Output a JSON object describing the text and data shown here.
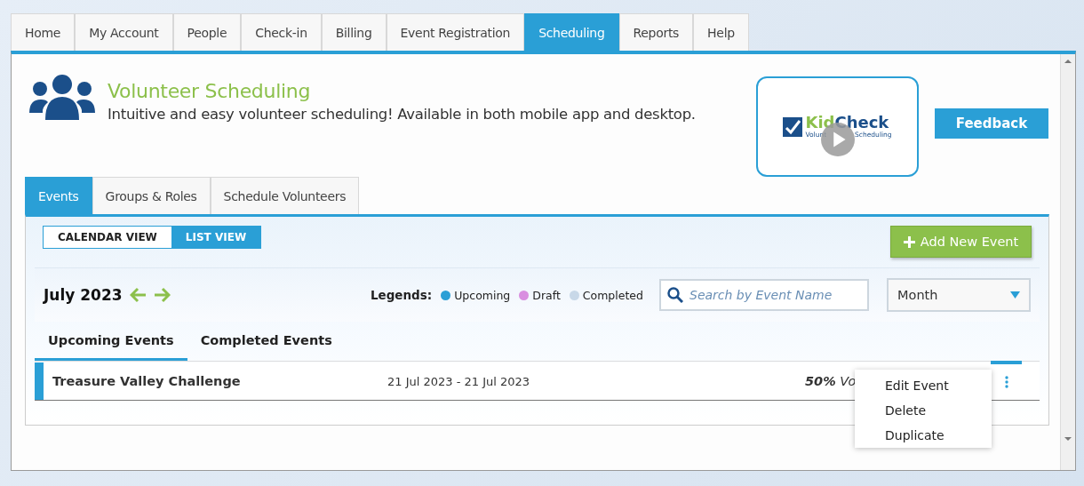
{
  "nav_tabs": [
    {
      "label": "Home",
      "selected": false
    },
    {
      "label": "My Account",
      "selected": false
    },
    {
      "label": "People",
      "selected": false
    },
    {
      "label": "Check-in",
      "selected": false
    },
    {
      "label": "Billing",
      "selected": false
    },
    {
      "label": "Event Registration",
      "selected": false
    },
    {
      "label": "Scheduling",
      "selected": true
    },
    {
      "label": "Reports",
      "selected": false
    },
    {
      "label": "Help",
      "selected": false
    }
  ],
  "header": {
    "title": "Volunteer Scheduling",
    "subtitle": "Intuitive and easy volunteer scheduling! Available in both mobile app and desktop.",
    "video": {
      "logo_part_1": "Kid",
      "logo_part_2": "Check",
      "tagline_part_1": "Volunt",
      "tagline_part_2": "Scheduling"
    },
    "feedback_button": "Feedback"
  },
  "section_tabs": [
    {
      "label": "Events",
      "selected": true
    },
    {
      "label": "Groups & Roles",
      "selected": false
    },
    {
      "label": "Schedule Volunteers",
      "selected": false
    }
  ],
  "view_toggle": [
    {
      "label": "CALENDAR VIEW",
      "selected": false
    },
    {
      "label": "LIST VIEW",
      "selected": true
    }
  ],
  "add_button": "Add New Event",
  "toolbar": {
    "period": "July 2023",
    "legends_label": "Legends:",
    "legends": [
      {
        "label": "Upcoming",
        "color": "#2a9fd6"
      },
      {
        "label": "Draft",
        "color": "#d98fe0"
      },
      {
        "label": "Completed",
        "color": "#c8d8e8"
      }
    ],
    "search": {
      "placeholder": "Search by Event Name"
    },
    "range": {
      "value": "Month"
    }
  },
  "event_tabs": [
    {
      "label": "Upcoming Events",
      "selected": true
    },
    {
      "label": "Completed Events",
      "selected": false
    }
  ],
  "events": [
    {
      "name": "Treasure Valley Challenge",
      "dates": "21 Jul 2023 - 21 Jul 2023",
      "volunteers": "**50%** Vo",
      "color": "#2a9fd6"
    }
  ],
  "context_menu": [
    "Edit Event",
    "Delete",
    "Duplicate"
  ]
}
